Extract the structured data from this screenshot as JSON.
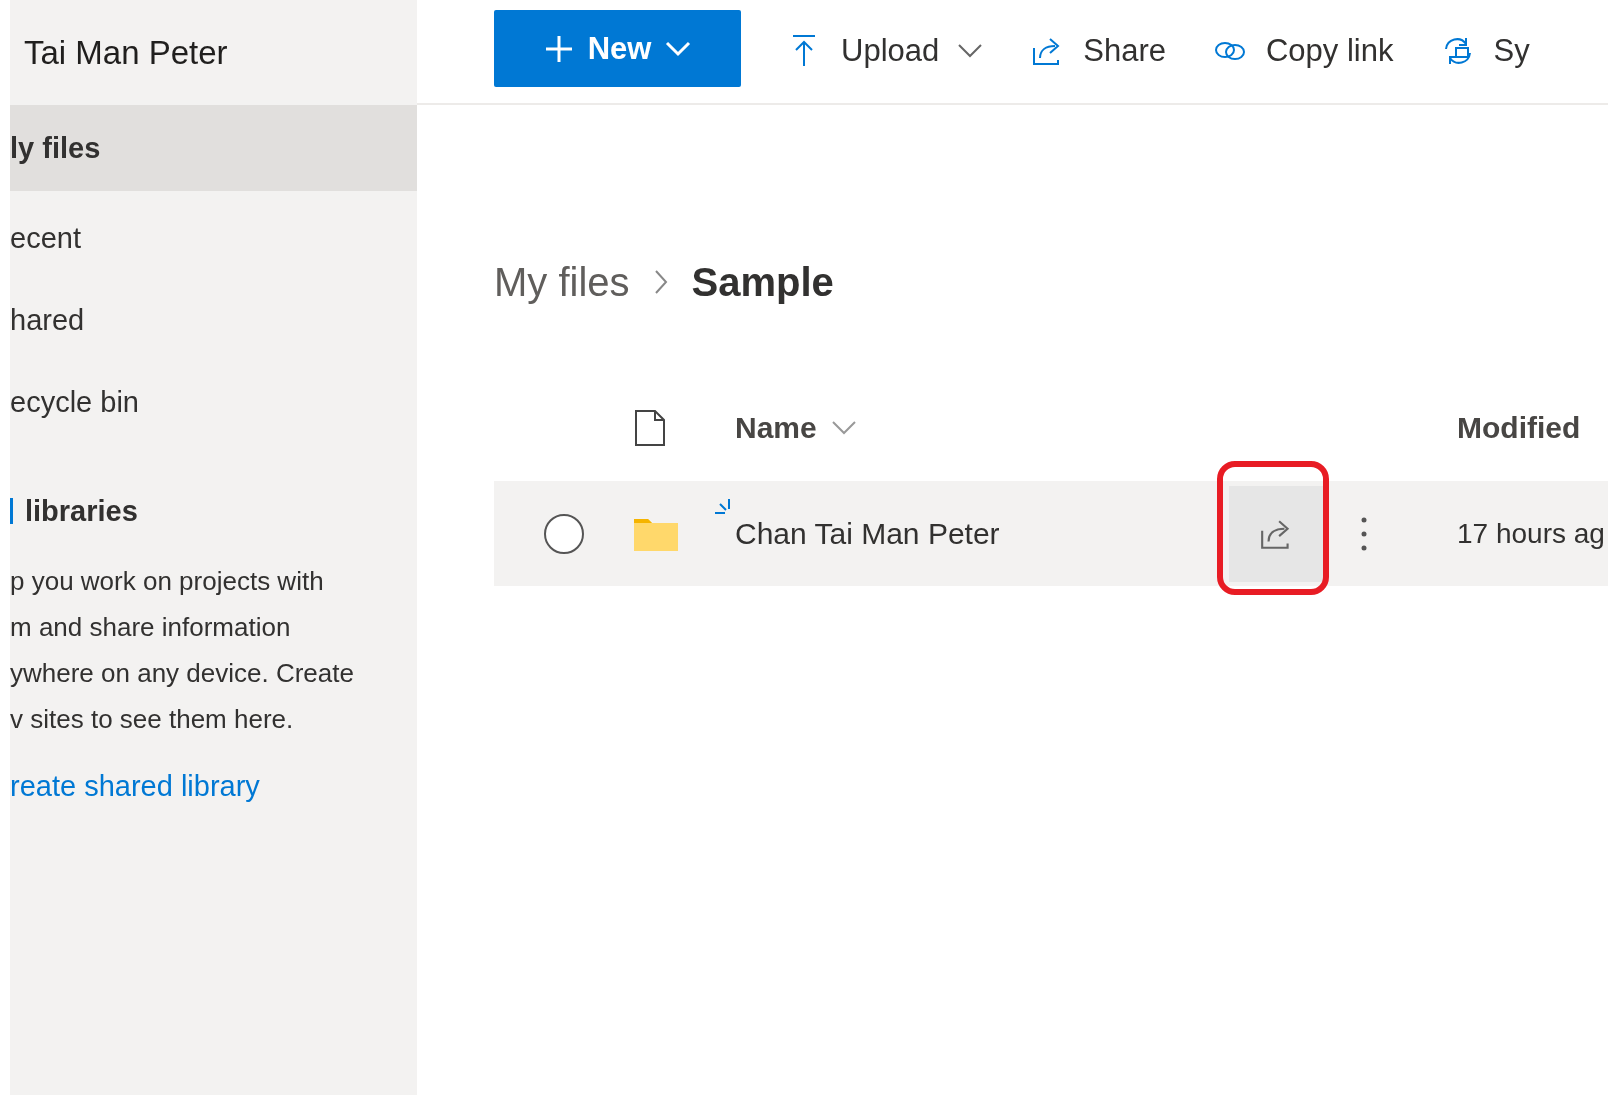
{
  "sidebar": {
    "title": "Tai Man Peter",
    "items": [
      {
        "label": "ly files",
        "selected": true
      },
      {
        "label": "ecent",
        "selected": false
      },
      {
        "label": "hared",
        "selected": false
      },
      {
        "label": "ecycle bin",
        "selected": false
      }
    ],
    "section": {
      "heading": "libraries",
      "text": "p you work on projects with\nm and share information\nywhere on any device. Create\nv sites to see them here.",
      "link": "reate shared library"
    }
  },
  "toolbar": {
    "new_button": "New",
    "commands": [
      {
        "kind": "upload",
        "label": "Upload",
        "dropdown": true
      },
      {
        "kind": "share",
        "label": "Share",
        "dropdown": false
      },
      {
        "kind": "link",
        "label": "Copy link",
        "dropdown": false
      },
      {
        "kind": "sync",
        "label": "Sy",
        "dropdown": false
      }
    ]
  },
  "breadcrumb": [
    {
      "label": "My files",
      "current": false
    },
    {
      "label": "Sample",
      "current": true
    }
  ],
  "table": {
    "columns": [
      "Name",
      "Modified"
    ],
    "rows": [
      {
        "name": "Chan Tai Man Peter",
        "modified": "17 hours ag",
        "selected": false,
        "new": true,
        "share_highlighted": true
      }
    ]
  }
}
